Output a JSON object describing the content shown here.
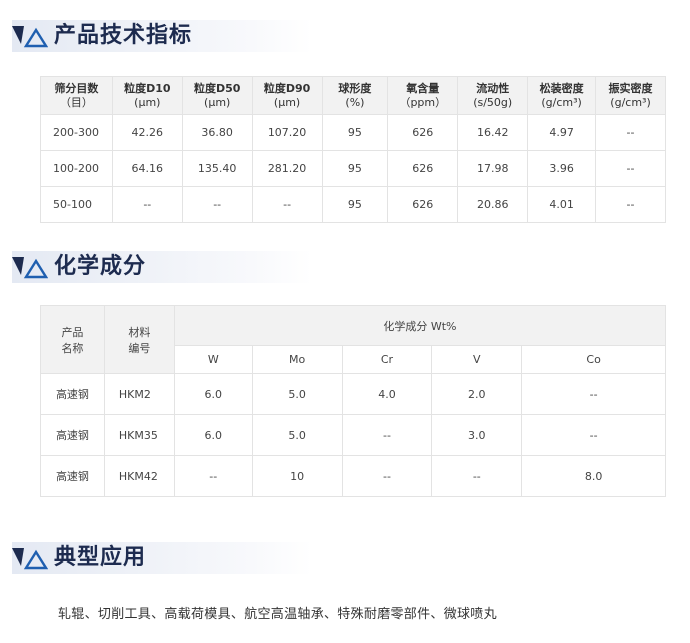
{
  "sections": {
    "specs_title": "产品技术指标",
    "chem_title": "化学成分",
    "app_title": "典型应用"
  },
  "specs_table": {
    "headers": [
      [
        "筛分目数",
        "（目）"
      ],
      [
        "粒度D10",
        "(μm)"
      ],
      [
        "粒度D50",
        "(μm)"
      ],
      [
        "粒度D90",
        "(μm)"
      ],
      [
        "球形度",
        "(%)"
      ],
      [
        "氧含量",
        "（ppm）"
      ],
      [
        "流动性",
        "(s/50g)"
      ],
      [
        "松装密度",
        "(g/cm³)"
      ],
      [
        "振实密度",
        "(g/cm³)"
      ]
    ],
    "rows": [
      [
        "200-300",
        "42.26",
        "36.80",
        "107.20",
        "95",
        "626",
        "16.42",
        "4.97",
        "--"
      ],
      [
        "100-200",
        "64.16",
        "135.40",
        "281.20",
        "95",
        "626",
        "17.98",
        "3.96",
        "--"
      ],
      [
        "50-100",
        "--",
        "--",
        "--",
        "95",
        "626",
        "20.86",
        "4.01",
        "--"
      ]
    ]
  },
  "chem_table": {
    "col_product": [
      "产品",
      "名称"
    ],
    "col_material": [
      "材料",
      "编号"
    ],
    "group_header": "化学成分 Wt%",
    "elements": [
      "W",
      "Mo",
      "Cr",
      "V",
      "Co"
    ],
    "rows": [
      [
        "高速钢",
        "HKM2",
        "6.0",
        "5.0",
        "4.0",
        "2.0",
        "--"
      ],
      [
        "高速钢",
        "HKM35",
        "6.0",
        "5.0",
        "--",
        "3.0",
        "--"
      ],
      [
        "高速钢",
        "HKM42",
        "--",
        "10",
        "--",
        "--",
        "8.0"
      ]
    ]
  },
  "applications": "轧辊、切削工具、高载荷模具、航空高温轴承、特殊耐磨零部件、微球喷丸",
  "colors": {
    "accent_dark": "#1d2b4f",
    "accent_blue": "#1f5fb0"
  }
}
